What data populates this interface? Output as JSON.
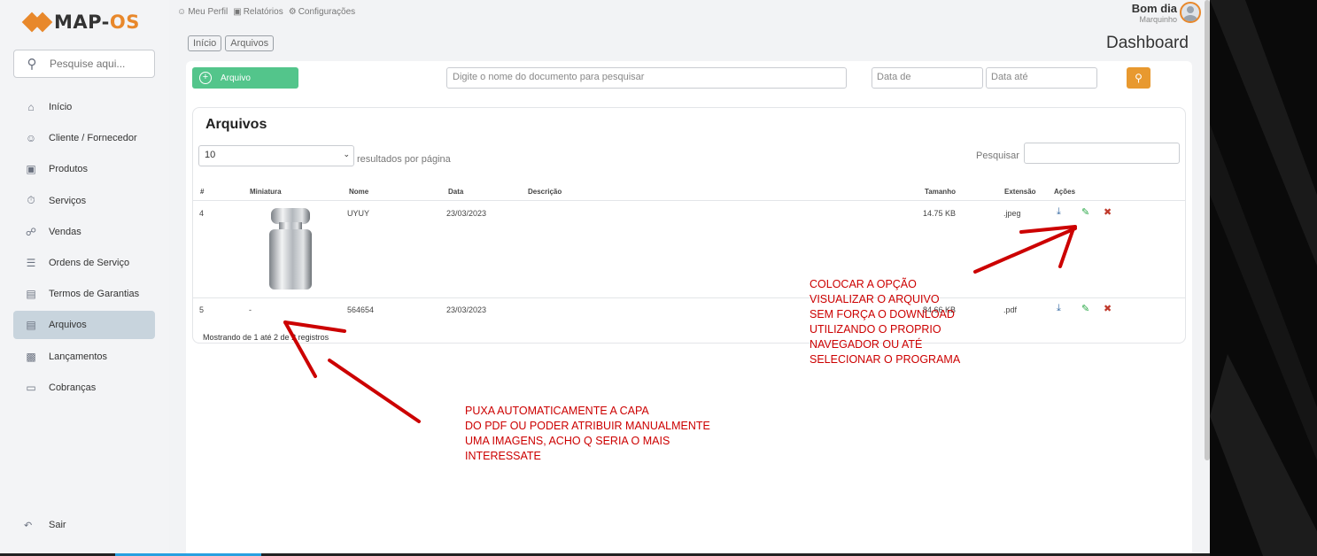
{
  "brand": {
    "name_main": "MAP-",
    "name_accent": "OS"
  },
  "sidebar": {
    "search_placeholder": "Pesquise aqui...",
    "items": [
      {
        "label": "Início",
        "icon": "home-icon"
      },
      {
        "label": "Cliente / Fornecedor",
        "icon": "users-icon"
      },
      {
        "label": "Produtos",
        "icon": "box-icon"
      },
      {
        "label": "Serviços",
        "icon": "stopwatch-icon"
      },
      {
        "label": "Vendas",
        "icon": "cart-icon"
      },
      {
        "label": "Ordens de Serviço",
        "icon": "list-icon"
      },
      {
        "label": "Termos de Garantias",
        "icon": "document-icon"
      },
      {
        "label": "Arquivos",
        "icon": "archive-icon",
        "active": true
      },
      {
        "label": "Lançamentos",
        "icon": "chart-icon"
      },
      {
        "label": "Cobranças",
        "icon": "card-icon"
      }
    ],
    "logout": "Sair"
  },
  "topbar": {
    "profile": "Meu Perfil",
    "reports": "Relatórios",
    "settings": "Configurações"
  },
  "greeting": {
    "hello": "Bom dia",
    "user": "Marquinho"
  },
  "breadcrumb": [
    "Início",
    "Arquivos"
  ],
  "page_title": "Dashboard",
  "toolbar": {
    "add_label": "Arquivo",
    "search_placeholder": "Digite o nome do documento para pesquisar",
    "date_from_placeholder": "Data de",
    "date_to_placeholder": "Data até"
  },
  "table_box": {
    "title": "Arquivos",
    "per_page": "10",
    "per_page_label": "resultados por página",
    "search_label": "Pesquisar",
    "columns": [
      "#",
      "Miniatura",
      "Nome",
      "Data",
      "Descrição",
      "Tamanho",
      "Extensão",
      "Ações"
    ],
    "rows": [
      {
        "id": "4",
        "thumb": "",
        "name": "UYUY",
        "date": "23/03/2023",
        "description": "",
        "size": "14.75 KB",
        "ext": ".jpeg"
      },
      {
        "id": "5",
        "thumb": "-",
        "name": "564654",
        "date": "23/03/2023",
        "description": "",
        "size": "84.66 KB",
        "ext": ".pdf"
      }
    ],
    "footer": "Mostrando de 1 até 2 de 2 registros"
  },
  "annotations": {
    "right": "COLOCAR A OPÇÃO\nVISUALIZAR O ARQUIVO\nSEM FORÇA O DOWNLOAD\nUTILIZANDO O PROPRIO\nNAVEGADOR OU ATÉ\nSELECIONAR O PROGRAMA",
    "bottom": "PUXA AUTOMATICAMENTE A CAPA\nDO PDF OU PODER ATRIBUIR MANUALMENTE\nUMA IMAGENS, ACHO Q SERIA O MAIS\nINTERESSATE",
    "color": "#cc0000"
  }
}
